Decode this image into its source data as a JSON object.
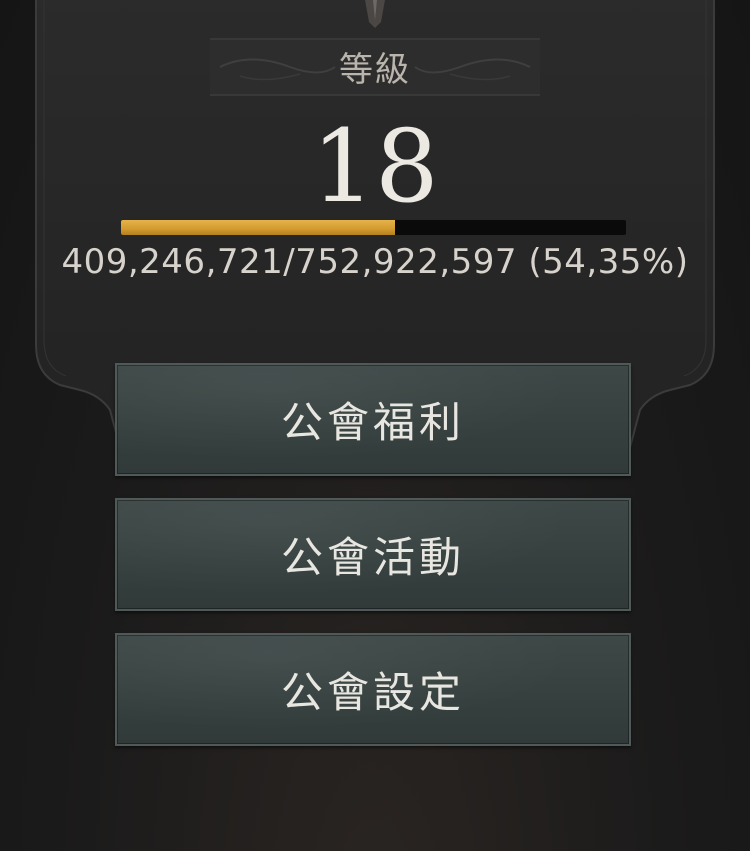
{
  "level_panel": {
    "title": "等級",
    "level": "18",
    "xp_text": "409,246,721/752,922,597 (54,35%)",
    "xp_fraction": 0.5435
  },
  "menu": {
    "items": [
      {
        "label": "公會福利"
      },
      {
        "label": "公會活動"
      },
      {
        "label": "公會設定"
      }
    ]
  },
  "colors": {
    "xp_fill": "#d9a43a",
    "xp_track": "#0a0a0a",
    "button_bg": "#374241",
    "button_border": "#4f5a58",
    "panel_bg": "#262626"
  },
  "icons": {
    "crest": "crest-icon",
    "title_ornament": "ornament-icon"
  }
}
